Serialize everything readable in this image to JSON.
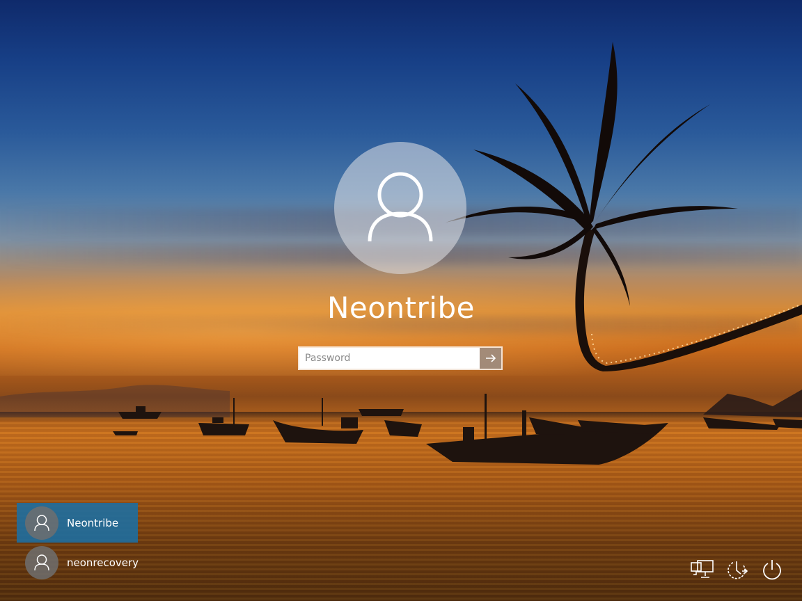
{
  "login": {
    "user_name": "Neontribe",
    "password_placeholder": "Password",
    "submit_icon": "arrow-right-icon"
  },
  "users": [
    {
      "name": "Neontribe",
      "selected": true
    },
    {
      "name": "neonrecovery",
      "selected": false
    }
  ],
  "corner_controls": [
    {
      "icon": "network-icon"
    },
    {
      "icon": "ease-of-access-icon"
    },
    {
      "icon": "power-icon"
    }
  ],
  "colors": {
    "selected_user_bg": "#1e6ea0",
    "avatar_circle": "#e1e1e6"
  }
}
